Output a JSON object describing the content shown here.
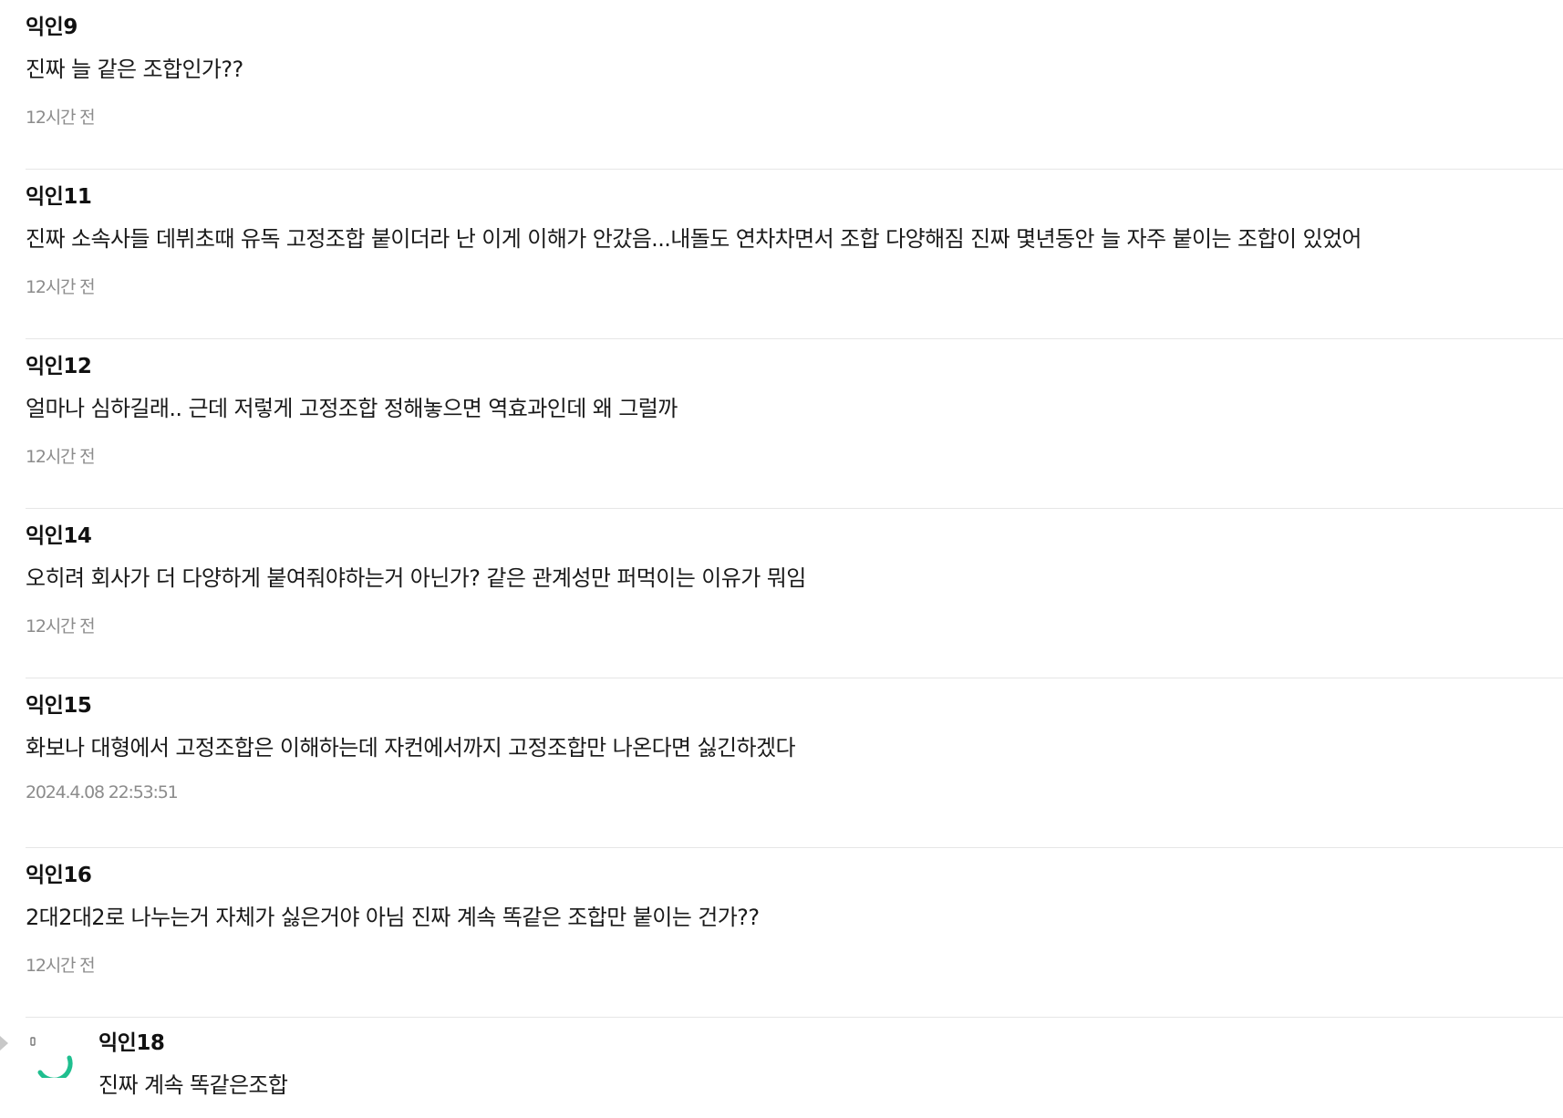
{
  "comments": [
    {
      "author": "익인9",
      "body": "진짜 늘 같은 조합인가??",
      "time": "12시간 전"
    },
    {
      "author": "익인11",
      "body": "진짜 소속사들 데뷔초때 유독 고정조합 붙이더라 난 이게 이해가 안갔음...내돌도 연차차면서 조합 다양해짐 진짜 몇년동안 늘 자주 붙이는 조합이 있었어",
      "time": "12시간 전"
    },
    {
      "author": "익인12",
      "body": "얼마나 심하길래.. 근데 저렇게 고정조합 정해놓으면 역효과인데 왜 그럴까",
      "time": "12시간 전"
    },
    {
      "author": "익인14",
      "body": "오히려 회사가 더 다양하게 붙여줘야하는거 아닌가? 같은 관계성만 퍼먹이는 이유가 뭐임",
      "time": "12시간 전"
    },
    {
      "author": "익인15",
      "body": "화보나 대형에서 고정조합은 이해하는데 자컨에서까지 고정조합만 나온다면 싫긴하겠다",
      "time": "2024.4.08 22:53:51"
    },
    {
      "author": "익인16",
      "body": "2대2대2로 나누는거 자체가 싫은거야 아님 진짜 계속 똑같은 조합만 붙이는 건가??",
      "time": "12시간 전"
    }
  ],
  "reply": {
    "author": "익인18",
    "body": "진짜 계속 똑같은조합",
    "spinner_color": "#1fbf8f",
    "icon": "loading-spinner-icon"
  },
  "colors": {
    "author": "#111111",
    "body": "#1a1a1a",
    "time": "#8c8c8c",
    "divider": "#e6e6e6",
    "accent": "#1fbf8f"
  }
}
